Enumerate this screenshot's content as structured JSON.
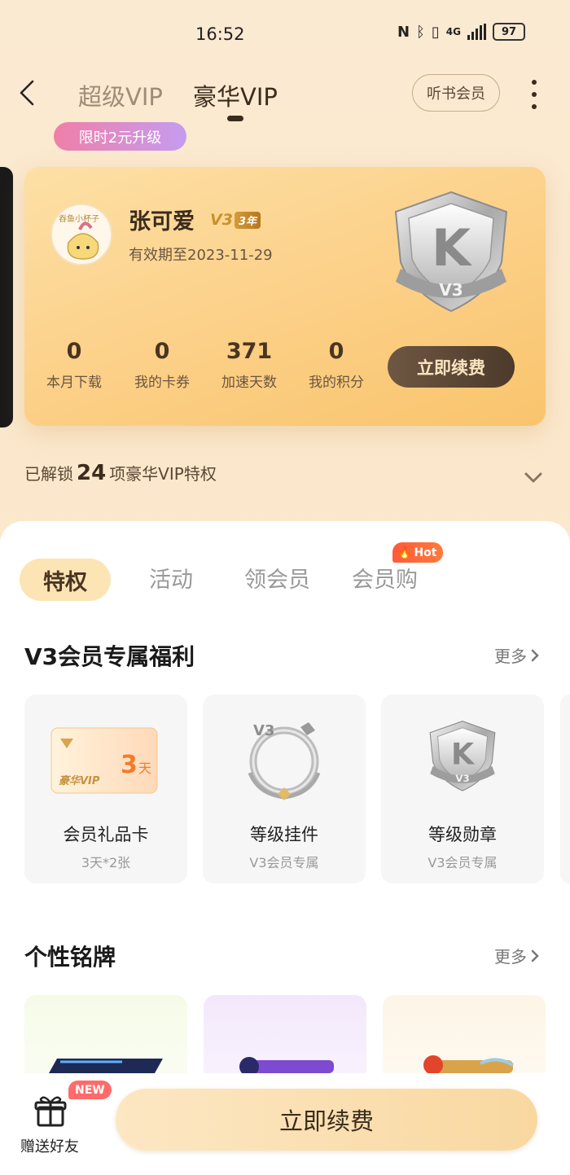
{
  "status_bar": {
    "time": "16:52",
    "network": "4G",
    "battery": "97"
  },
  "header": {
    "tabs": [
      {
        "label": "超级VIP",
        "active": false
      },
      {
        "label": "豪华VIP",
        "active": true
      }
    ],
    "listen_button": "听书会员",
    "promo_badge": "限时2元升级"
  },
  "member_card": {
    "username": "张可爱",
    "level_prefix": "V",
    "level_num": "3",
    "level_years": "3年",
    "expire_text": "有效期至2023-11-29",
    "badge_letter": "K",
    "badge_level": "V3",
    "stats": [
      {
        "value": "0",
        "label": "本月下载"
      },
      {
        "value": "0",
        "label": "我的卡券"
      },
      {
        "value": "371",
        "label": "加速天数"
      },
      {
        "value": "0",
        "label": "我的积分"
      }
    ],
    "renew_button": "立即续费"
  },
  "unlocked": {
    "prefix": "已解锁",
    "count": "24",
    "suffix": "项豪华VIP特权"
  },
  "segment_tabs": [
    {
      "label": "特权",
      "active": true
    },
    {
      "label": "活动",
      "active": false
    },
    {
      "label": "领会员",
      "active": false
    },
    {
      "label": "会员购",
      "active": false,
      "badge": "Hot"
    }
  ],
  "benefits_section": {
    "title": "V3会员专属福利",
    "more": "更多",
    "items": [
      {
        "name": "会员礼品卡",
        "sub": "3天*2张",
        "card_text": "豪华VIP",
        "card_days": "3",
        "card_unit": "天"
      },
      {
        "name": "等级挂件",
        "sub": "V3会员专属",
        "pendant_label": "V3"
      },
      {
        "name": "等级勋章",
        "sub": "V3会员专属",
        "medal_letter": "K",
        "medal_level": "V3"
      }
    ]
  },
  "nameplate_section": {
    "title": "个性铭牌",
    "more": "更多"
  },
  "bottom_bar": {
    "gift_label": "赠送好友",
    "new_badge": "NEW",
    "renew_button": "立即续费"
  },
  "colors": {
    "accent_dark": "#3b2b1c",
    "card_gold": "#fcd28c",
    "hot_red": "#ff5a3c",
    "promo_pink": "#f07fa8"
  }
}
